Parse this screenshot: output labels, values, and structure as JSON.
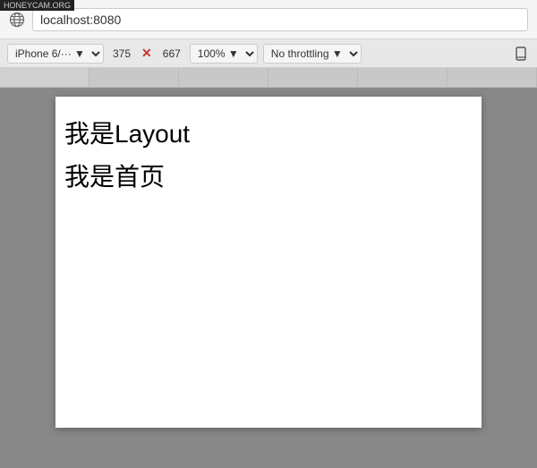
{
  "watermark": {
    "text": "HONEYCAM.ORG"
  },
  "address_bar": {
    "url": "localhost:8080",
    "globe_symbol": "🌐"
  },
  "toolbar": {
    "device_label": "iPhone 6/··· ▼",
    "width": "375",
    "height": "667",
    "zoom_label": "100% ▼",
    "throttling_label": "No throttling ▼",
    "rotate_symbol": "⬡"
  },
  "tabs": [
    {
      "id": "tab1"
    },
    {
      "id": "tab2"
    },
    {
      "id": "tab3"
    },
    {
      "id": "tab4"
    },
    {
      "id": "tab5"
    },
    {
      "id": "tab6"
    }
  ],
  "page": {
    "layout_text": "我是Layout",
    "home_text": "我是首页"
  }
}
